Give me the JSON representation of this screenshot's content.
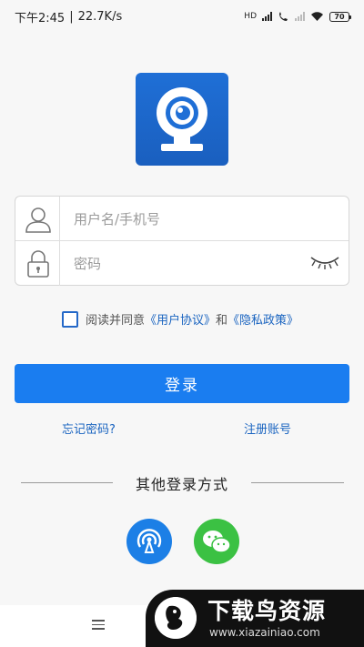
{
  "status_bar": {
    "time": "下午2:45",
    "separator": "|",
    "speed": "22.7K/s",
    "network_type": "HD",
    "battery": "70"
  },
  "app_logo": {
    "icon": "webcam-icon",
    "bg": "#1f6fd6"
  },
  "form": {
    "username": {
      "icon": "user-icon",
      "placeholder": "用户名/手机号",
      "value": ""
    },
    "password": {
      "icon": "lock-icon",
      "placeholder": "密码",
      "value": "",
      "toggle_icon": "eye-closed-icon"
    }
  },
  "agreement": {
    "checked": false,
    "prefix": "阅读并同意",
    "user_agreement": "《用户协议》",
    "joiner": "和",
    "privacy_policy": "《隐私政策》"
  },
  "login_button": {
    "label": "登录",
    "color": "#1a7df0"
  },
  "links": {
    "forgot_password": "忘记密码?",
    "register": "注册账号"
  },
  "other_login": {
    "title": "其他登录方式",
    "options": [
      {
        "icon": "signal-broadcast-icon",
        "color": "#1c7fe6"
      },
      {
        "icon": "wechat-icon",
        "color": "#3bc143"
      }
    ]
  },
  "nav_bar": {
    "menu_icon": "menu-icon"
  },
  "watermark": {
    "title": "下载鸟资源",
    "url": "www.xiazainiao.com"
  }
}
